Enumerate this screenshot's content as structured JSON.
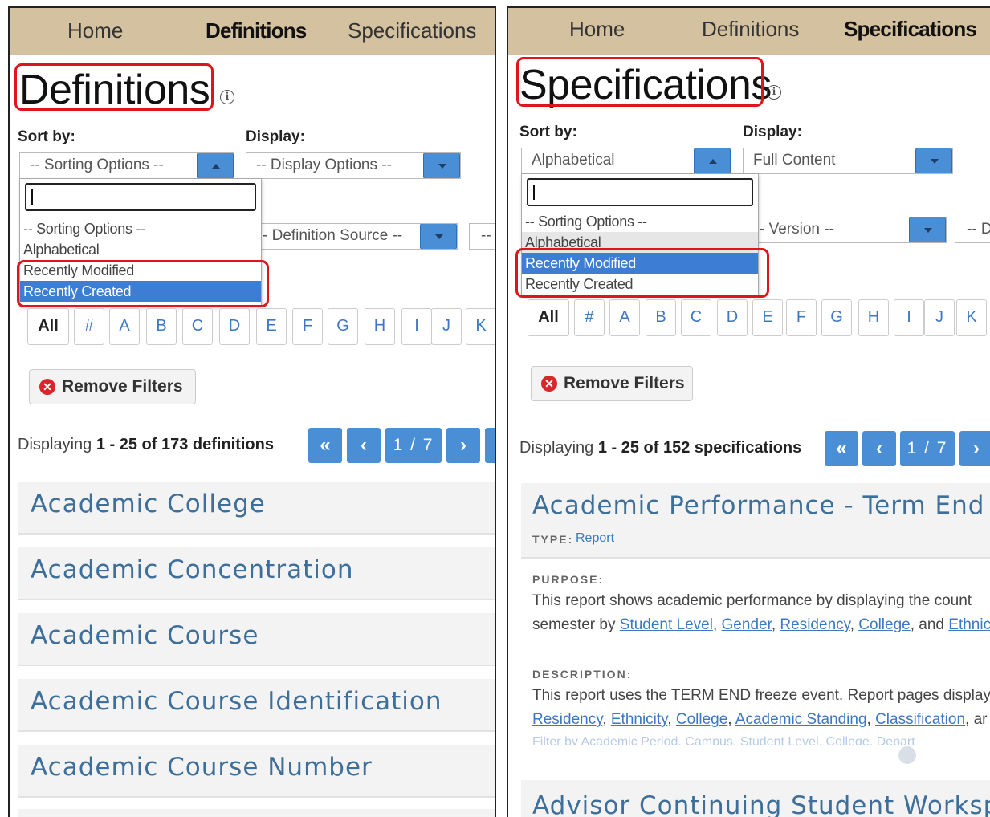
{
  "left": {
    "nav": {
      "home": "Home",
      "definitions": "Definitions",
      "specifications": "Specifications"
    },
    "title": "Definitions",
    "info_icon": "info-icon",
    "sort_label": "Sort by:",
    "display_label": "Display:",
    "sort_value": "-- Sorting Options --",
    "display_value": "-- Display Options --",
    "definition_source": "- Definition Source --",
    "third_filter": "--",
    "sort_options": [
      "-- Sorting Options --",
      "Alphabetical",
      "Recently Modified",
      "Recently Created"
    ],
    "letters": [
      "All",
      "#",
      "A",
      "B",
      "C",
      "D",
      "E",
      "F",
      "G",
      "H",
      "I",
      "J",
      "K"
    ],
    "remove_filters": "Remove Filters",
    "displaying_prefix": "Displaying",
    "displaying_range": "1 - 25 of 173 definitions",
    "pager": {
      "first": "«",
      "prev": "‹",
      "page": "1 / 7",
      "next": "›"
    },
    "items": [
      "Academic College",
      "Academic Concentration",
      "Academic Course",
      "Academic Course Identification",
      "Academic Course Number"
    ]
  },
  "right": {
    "nav": {
      "home": "Home",
      "definitions": "Definitions",
      "specifications": "Specifications"
    },
    "title": "Specifications",
    "info_icon": "info-icon",
    "sort_label": "Sort by:",
    "display_label": "Display:",
    "sort_value": "Alphabetical",
    "display_value": "Full Content",
    "version": "- Version --",
    "third_filter": "-- D",
    "sort_options": [
      "-- Sorting Options --",
      "Alphabetical",
      "Recently Modified",
      "Recently Created"
    ],
    "letters": [
      "All",
      "#",
      "A",
      "B",
      "C",
      "D",
      "E",
      "F",
      "G",
      "H",
      "I",
      "J",
      "K"
    ],
    "remove_filters": "Remove Filters",
    "displaying_prefix": "Displaying",
    "displaying_range": "1 - 25 of 152 specifications",
    "pager": {
      "first": "«",
      "prev": "‹",
      "page": "1 / 7",
      "next": "›"
    },
    "spec": {
      "title": "Academic Performance - Term End",
      "type_label": "TYPE:",
      "type_value": "Report",
      "purpose_label": "PURPOSE:",
      "purpose_line1": "This report shows academic performance by displaying the count",
      "purpose_line2_prefix": "semester by",
      "purpose_links": [
        "Student Level",
        "Gender",
        "Residency",
        "College"
      ],
      "purpose_and": "and",
      "purpose_last": "Ethnic",
      "description_label": "DESCRIPTION:",
      "description_line1": "This report uses the TERM END freeze event. Report pages display",
      "description_links": [
        "Residency",
        "Ethnicity",
        "College",
        "Academic Standing",
        "Classification"
      ],
      "description_tail": "ar",
      "faded_line": "Filter by Academic Period, Campus, Student Level, College, Depart"
    },
    "next_title": "Advisor Continuing Student Workspac"
  },
  "colors": {
    "nav_bg": "#d4c19f",
    "accent_blue": "#4a8fd6",
    "highlight": "#3d7ed4",
    "annotation_red": "#e0151c",
    "link": "#3e78c2"
  }
}
